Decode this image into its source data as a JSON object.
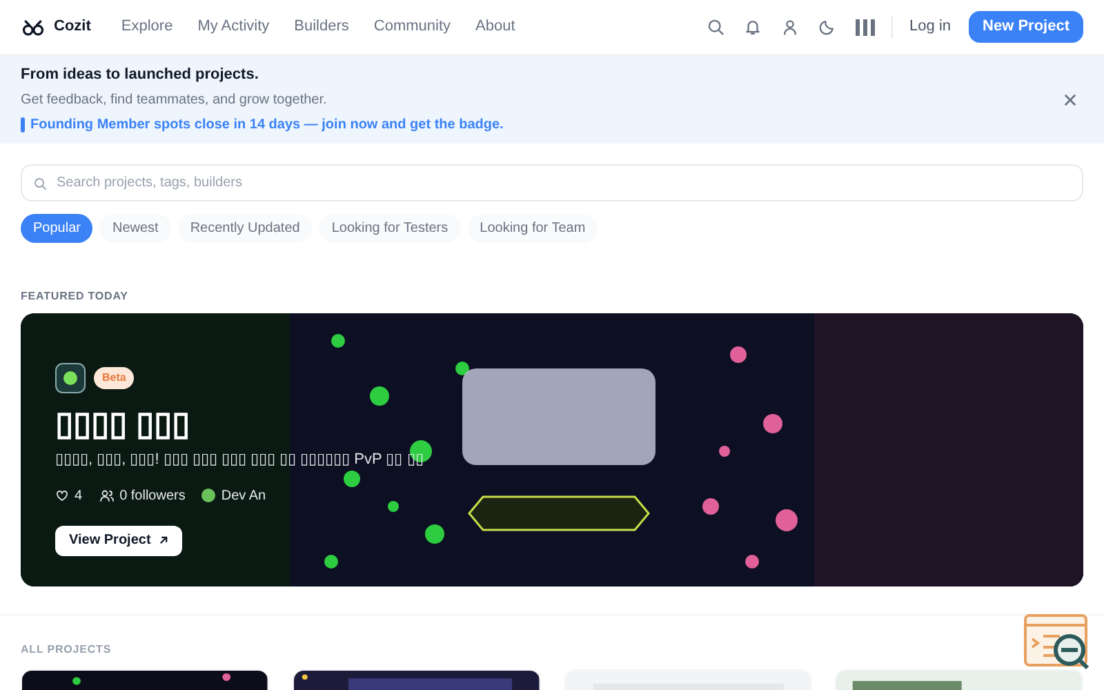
{
  "nav": {
    "brand": "Cozit",
    "links": [
      "Explore",
      "My Activity",
      "Builders",
      "Community",
      "About"
    ],
    "login": "Log in",
    "new_project": "New Project"
  },
  "announcement": {
    "title": "From ideas to launched projects.",
    "subtitle": "Get feedback, find teammates, and grow together.",
    "link": "Founding Member spots close in 14 days — join now and get the badge."
  },
  "search": {
    "placeholder": "Search projects, tags, builders"
  },
  "filters": [
    {
      "label": "Popular",
      "selected": true
    },
    {
      "label": "Newest",
      "selected": false
    },
    {
      "label": "Recently Updated",
      "selected": false
    },
    {
      "label": "Looking for Testers",
      "selected": false
    },
    {
      "label": "Looking for Team",
      "selected": false
    }
  ],
  "featured": {
    "heading": "FEATURED TODAY",
    "badge": "Beta",
    "title": "▯▯▯▯ ▯▯▯",
    "description": "▯▯▯▯, ▯▯▯, ▯▯▯! ▯▯▯ ▯▯▯ ▯▯▯ ▯▯▯ ▯▯ ▯▯▯▯▯▯ PvP ▯▯ ▯▯",
    "likes": "4",
    "followers": "0 followers",
    "author": "Dev An",
    "button": "View Project"
  },
  "all_projects": {
    "heading": "ALL PROJECTS"
  }
}
